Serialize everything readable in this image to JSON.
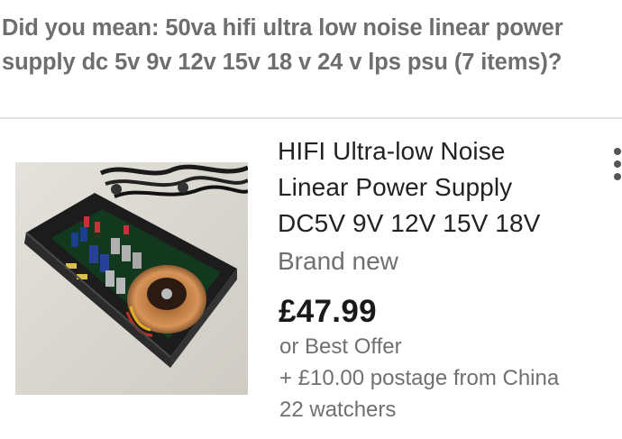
{
  "suggestion": {
    "line1": "Did you mean: 50va hifi ultra low noise linear power",
    "line2": "supply dc 5v 9v 12v 15v 18 v 24 v lps psu (7 items)?"
  },
  "listing": {
    "title_lines": [
      "HIFI Ultra-low Noise",
      "Linear Power Supply",
      "DC5V 9V 12V 15V 18V"
    ],
    "condition": "Brand new",
    "price": "£47.99",
    "offer": "or Best Offer",
    "postage": "+ £10.00 postage from China",
    "watchers": "22 watchers",
    "more_icon": "vertical-ellipsis-icon",
    "image_icon": "product-photo-linear-power-supply"
  },
  "colors": {
    "suggestion_text": "#6e6e6e",
    "title_text": "#222222",
    "secondary_text": "#707070",
    "price_text": "#191919",
    "divider": "#e3e3e3"
  }
}
